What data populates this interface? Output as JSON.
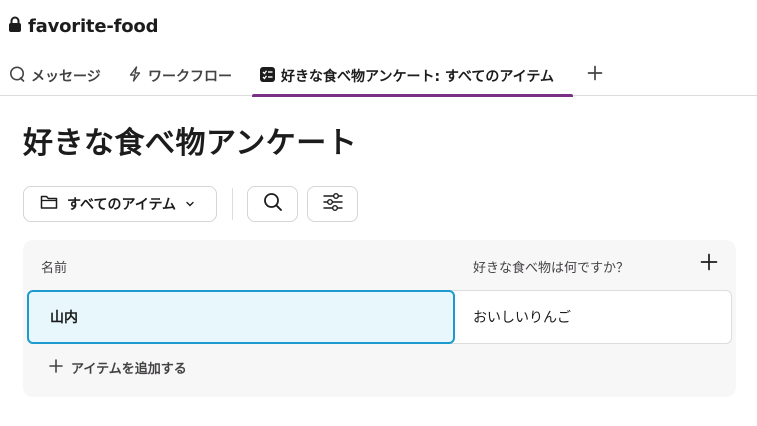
{
  "channel": {
    "name": "favorite-food"
  },
  "tabs": [
    {
      "label": "メッセージ",
      "icon": "message-bubble-icon"
    },
    {
      "label": "ワークフロー",
      "icon": "lightning-icon"
    },
    {
      "label": "好きな食べ物アンケート: すべてのアイテム",
      "icon": "list-icon",
      "active": true
    }
  ],
  "page": {
    "title": "好きな食べ物アンケート"
  },
  "toolbar": {
    "view_label": "すべてのアイテム"
  },
  "table": {
    "columns": [
      "名前",
      "好きな食べ物は何ですか？"
    ],
    "rows": [
      {
        "name": "山内",
        "food": "おいしいりんご"
      }
    ],
    "add_item_label": "アイテムを追加する"
  },
  "colors": {
    "accent": "#7c3085",
    "selection_border": "#1d9bd1",
    "selection_fill": "#e8f7fc"
  }
}
